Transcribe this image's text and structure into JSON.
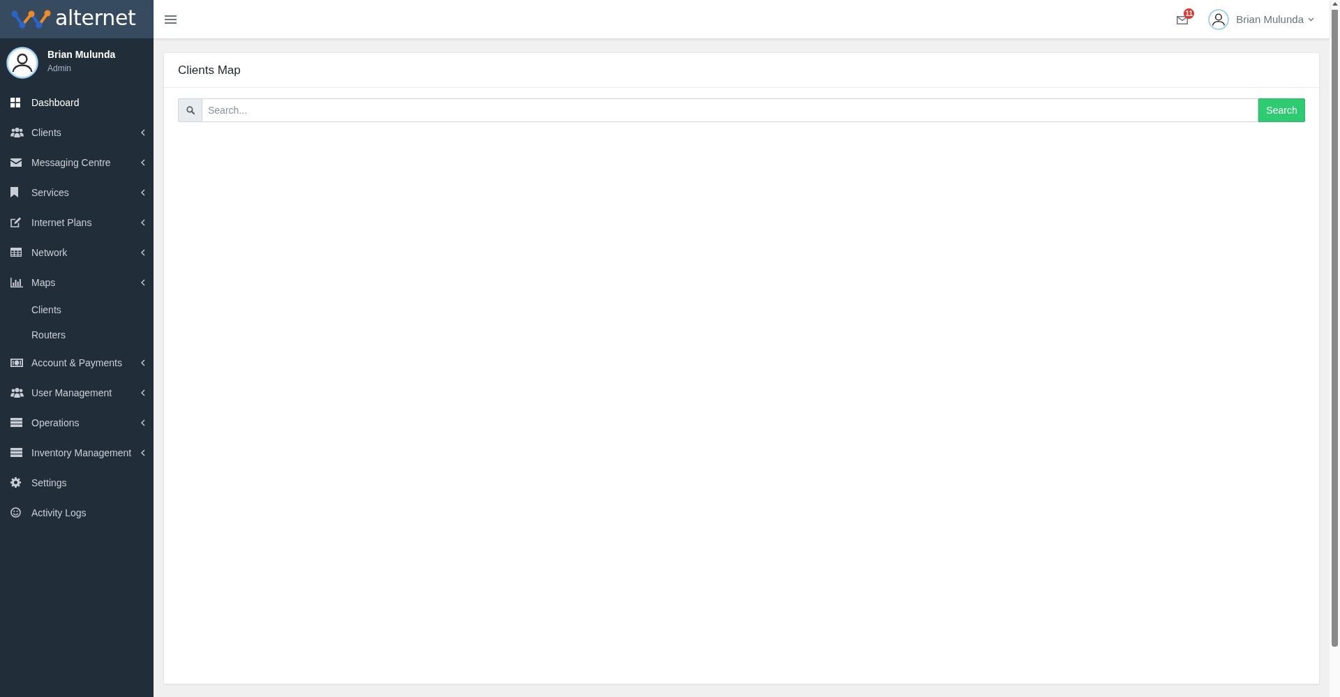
{
  "brand": {
    "name": "alternet"
  },
  "user_panel": {
    "name": "Brian Mulunda",
    "role": "Admin"
  },
  "sidebar": {
    "items": [
      {
        "label": "Dashboard",
        "kind": "link",
        "selected": true
      },
      {
        "label": "Clients",
        "kind": "submenu",
        "selected": false
      },
      {
        "label": "Messaging Centre",
        "kind": "submenu",
        "selected": false
      },
      {
        "label": "Services",
        "kind": "submenu",
        "selected": false
      },
      {
        "label": "Internet Plans",
        "kind": "submenu",
        "selected": false
      },
      {
        "label": "Network",
        "kind": "submenu",
        "selected": false
      },
      {
        "label": "Maps",
        "kind": "submenu",
        "selected": false,
        "children": [
          {
            "label": "Clients",
            "selected": false
          },
          {
            "label": "Routers",
            "selected": false
          }
        ]
      },
      {
        "label": "Account & Payments",
        "kind": "submenu",
        "selected": false
      },
      {
        "label": "User Management",
        "kind": "submenu",
        "selected": false
      },
      {
        "label": "Operations",
        "kind": "submenu",
        "selected": false
      },
      {
        "label": "Inventory Management",
        "kind": "submenu",
        "selected": false
      },
      {
        "label": "Settings",
        "kind": "link",
        "selected": false
      },
      {
        "label": "Activity Logs",
        "kind": "link",
        "selected": false
      }
    ]
  },
  "topbar": {
    "notifications": {
      "count": "11"
    },
    "user": {
      "name": "Brian Mulunda"
    }
  },
  "card": {
    "title": "Clients Map",
    "search": {
      "placeholder": "Search...",
      "button": "Search"
    }
  }
}
